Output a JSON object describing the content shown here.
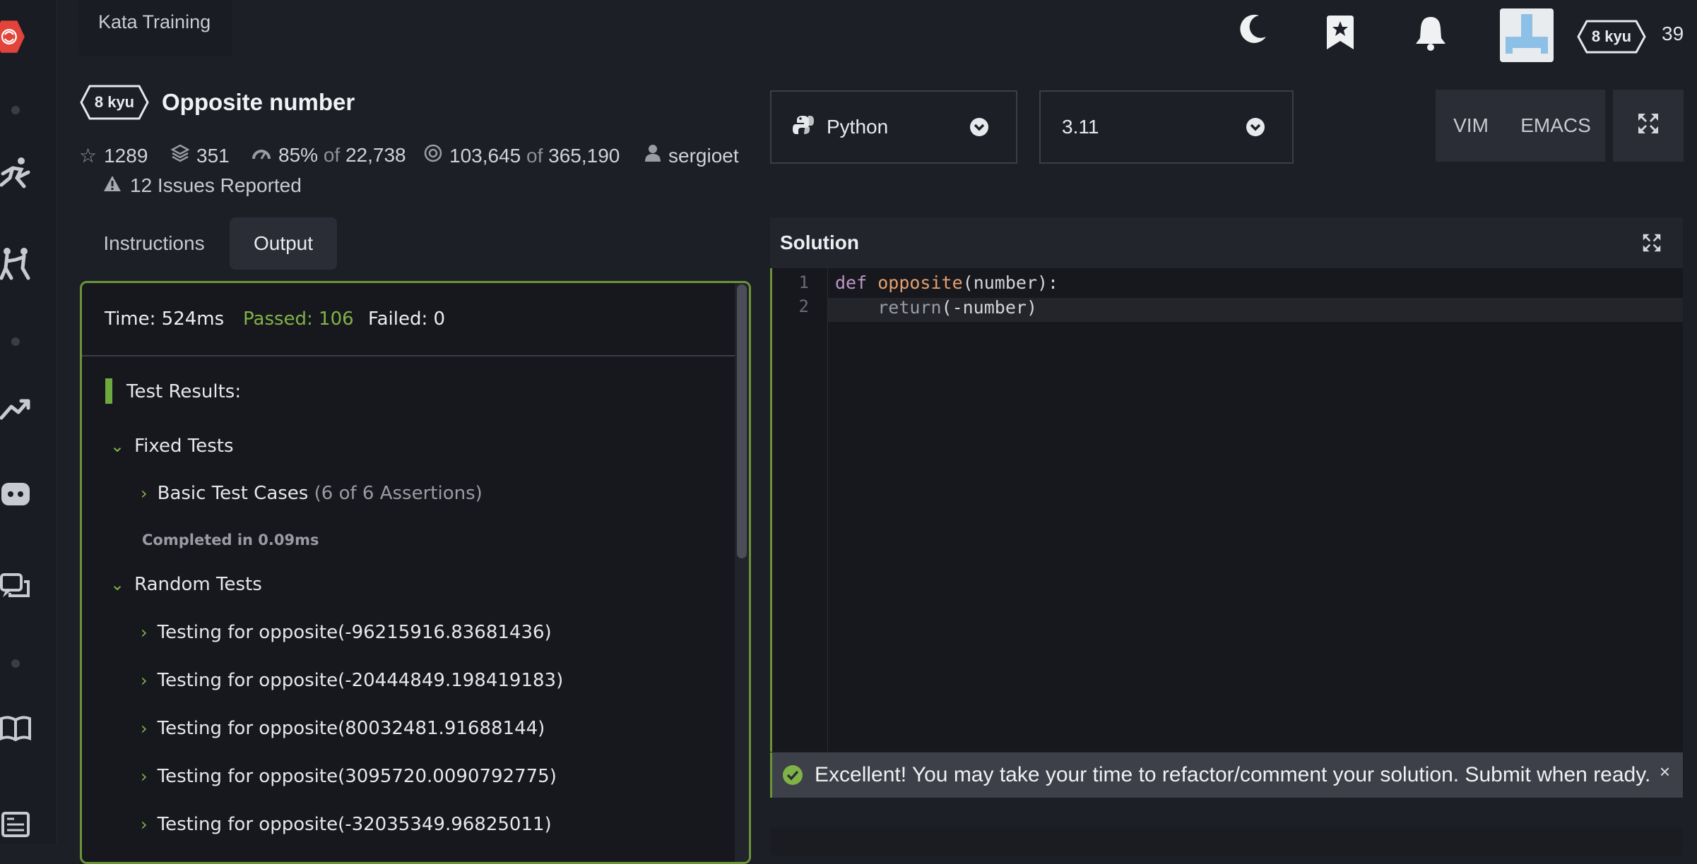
{
  "header": {
    "kata_tab": "Kata Training",
    "rank_badge": "8 kyu",
    "honor": "39"
  },
  "kata": {
    "rank": "8 kyu",
    "title": "Opposite number",
    "stats": {
      "stars": "1289",
      "collections": "351",
      "satisfaction_pct": "85%",
      "of": "of",
      "votes": "22,738",
      "completed": "103,645",
      "attempts": "365,190",
      "author": "sergioet"
    },
    "issues": "12 Issues Reported"
  },
  "tabs": [
    "Instructions",
    "Output"
  ],
  "output": {
    "time": "Time: 524ms",
    "passed": "Passed: 106",
    "failed": "Failed: 0",
    "results_title": "Test Results:",
    "fixed_group": "Fixed Tests",
    "basic_cases": "Basic Test Cases",
    "basic_assertions": "(6 of 6 Assertions)",
    "completed_in": "Completed in 0.09ms",
    "random_group": "Random Tests",
    "random_tests": [
      "Testing for opposite(-96215916.83681436)",
      "Testing for opposite(-20444849.198419183)",
      "Testing for opposite(80032481.91688144)",
      "Testing for opposite(3095720.0090792775)",
      "Testing for opposite(-32035349.96825011)"
    ]
  },
  "editor": {
    "language": "Python",
    "version": "3.11",
    "modes": [
      "VIM",
      "EMACS"
    ],
    "panel_title": "Solution",
    "line_numbers": [
      "1",
      "2"
    ],
    "code": {
      "l1_kw": "def",
      "l1_fn": "opposite",
      "l1_rest": "(number):",
      "l2_indent": "    ",
      "l2_kw": "return",
      "l2_rest": "(-number)"
    }
  },
  "toast": {
    "message": "Excellent! You may take your time to refactor/comment your solution. Submit when ready.",
    "close": "×"
  },
  "colors": {
    "accent_green": "#6b9437",
    "passed_green": "#7fb347",
    "background": "#1d1f27"
  }
}
